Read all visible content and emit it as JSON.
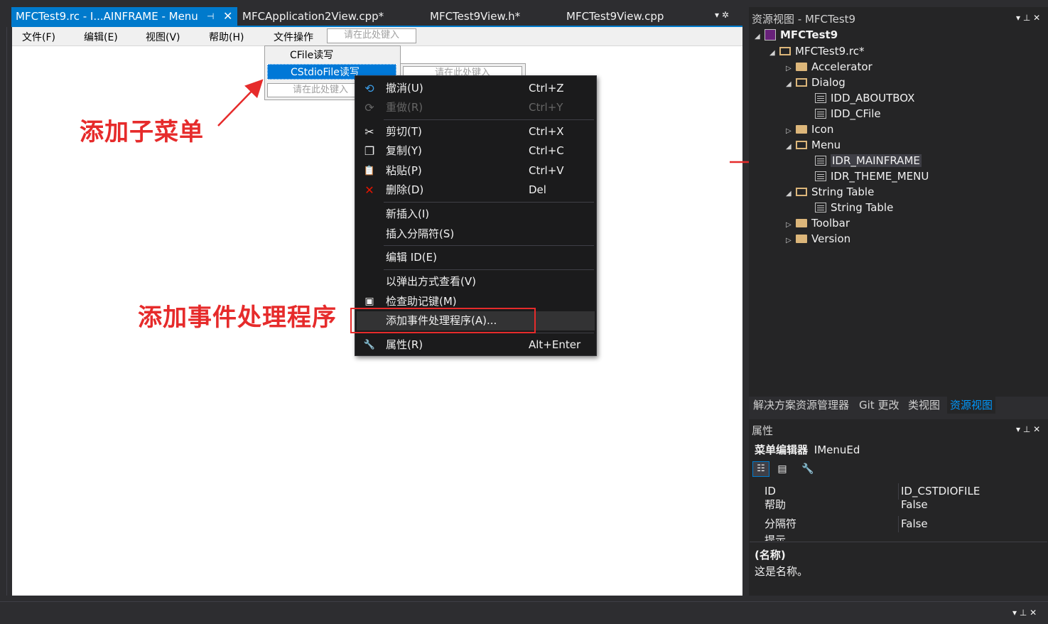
{
  "tabs": {
    "active": {
      "label": "MFCTest9.rc - I...AINFRAME - Menu",
      "pin": "⊣",
      "close": "✕"
    },
    "others": [
      "MFCApplication2View.cpp*",
      "MFCTest9View.h*",
      "MFCTest9View.cpp"
    ],
    "controls": "▾ ✲"
  },
  "menubar": {
    "items": [
      "文件(F)",
      "编辑(E)",
      "视图(V)",
      "帮助(H)",
      "文件操作"
    ],
    "type_here": "请在此处键入"
  },
  "dropdown": {
    "items": [
      "CFile读写",
      "CStdioFile读写"
    ],
    "type_here": "请在此处键入",
    "submenu_type_here": "请在此处键入"
  },
  "context_menu": {
    "items": [
      {
        "label": "撤消(U)",
        "shortcut": "Ctrl+Z",
        "icon": "undo-icon",
        "glyph": "⟲"
      },
      {
        "label": "重做(R)",
        "shortcut": "Ctrl+Y",
        "icon": "redo-icon",
        "glyph": "⟳"
      },
      {
        "label": "剪切(T)",
        "shortcut": "Ctrl+X",
        "icon": "cut-icon",
        "glyph": "✂"
      },
      {
        "label": "复制(Y)",
        "shortcut": "Ctrl+C",
        "icon": "copy-icon",
        "glyph": "❐"
      },
      {
        "label": "粘贴(P)",
        "shortcut": "Ctrl+V",
        "icon": "paste-icon",
        "glyph": "📋"
      },
      {
        "label": "删除(D)",
        "shortcut": "Del",
        "icon": "delete-icon",
        "glyph": "✕"
      },
      {
        "label": "新插入(I)"
      },
      {
        "label": "插入分隔符(S)"
      },
      {
        "label": "编辑 ID(E)"
      },
      {
        "label": "以弹出方式查看(V)"
      },
      {
        "label": "检查助记键(M)",
        "icon": "check-mnemonics-icon",
        "glyph": "▣"
      },
      {
        "label": "添加事件处理程序(A)..."
      },
      {
        "label": "属性(R)",
        "shortcut": "Alt+Enter",
        "icon": "wrench-icon",
        "glyph": "🔧"
      }
    ]
  },
  "annotations": {
    "add_submenu": "添加子菜单",
    "add_event_handler": "添加事件处理程序"
  },
  "resource_view": {
    "title": "资源视图 - MFCTest9",
    "controls": "▾ ⊥ ✕",
    "tree": [
      {
        "label": "MFCTest9"
      },
      {
        "label": "MFCTest9.rc*"
      },
      {
        "label": "Accelerator"
      },
      {
        "label": "Dialog"
      },
      {
        "label": "IDD_ABOUTBOX"
      },
      {
        "label": "IDD_CFile"
      },
      {
        "label": "Icon"
      },
      {
        "label": "Menu"
      },
      {
        "label": "IDR_MAINFRAME"
      },
      {
        "label": "IDR_THEME_MENU"
      },
      {
        "label": "String Table"
      },
      {
        "label": "String Table"
      },
      {
        "label": "Toolbar"
      },
      {
        "label": "Version"
      }
    ]
  },
  "panel_tabs": [
    "解决方案资源管理器",
    "Git 更改",
    "类视图",
    "资源视图"
  ],
  "properties": {
    "title": "属性",
    "controls": "▾ ⊥ ✕",
    "object": "菜单编辑器",
    "object_type": "IMenuEd",
    "rows": [
      {
        "key": "ID",
        "value": "ID_CSTDIOFILE"
      },
      {
        "key": "帮助",
        "value": "False"
      },
      {
        "key": "分隔符",
        "value": "False"
      },
      {
        "key": "提示",
        "value": ""
      }
    ],
    "desc_title": "(名称)",
    "desc_text": "这是名称。"
  },
  "bottom_controls": "▾ ⊥ ✕",
  "colors": {
    "accent": "#007acc",
    "annotation": "#e62b2b",
    "menu_highlight": "#0078d7"
  }
}
